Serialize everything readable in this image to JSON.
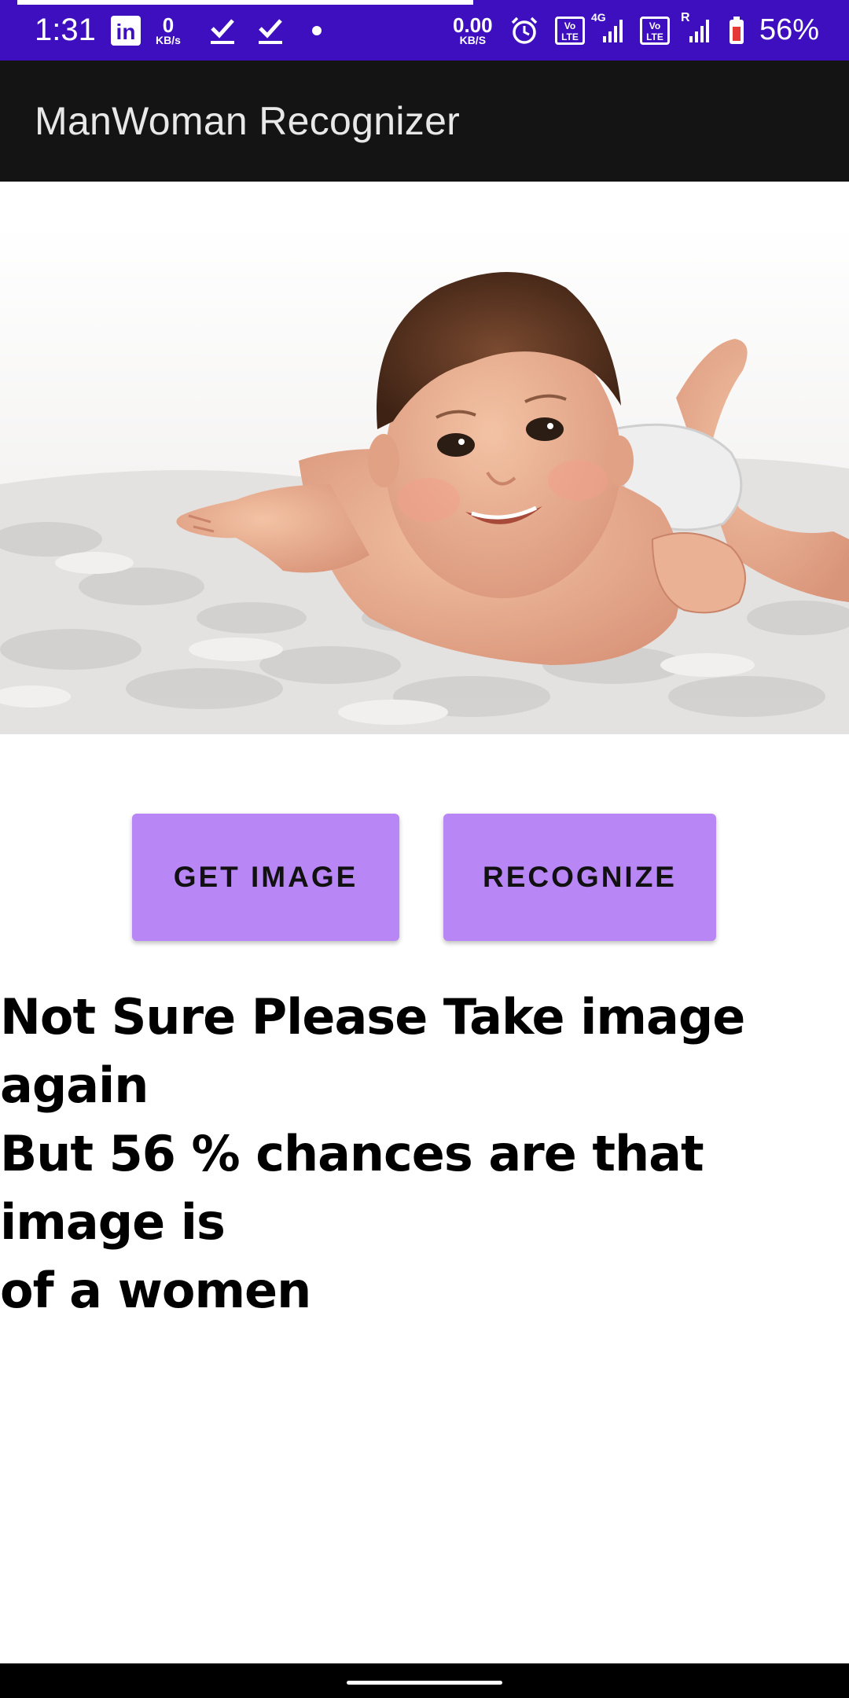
{
  "status_bar": {
    "time": "1:31",
    "speed_left_value": "0",
    "speed_left_unit": "KB/s",
    "speed_right_value": "0.00",
    "speed_right_unit": "KB/S",
    "sim1_network": "4G",
    "sim1_badge": "Vo LTE",
    "sim2_badge": "Vo LTE",
    "sim2_roaming": "R",
    "battery": "56%"
  },
  "app_bar": {
    "title": "ManWoman Recognizer"
  },
  "buttons": {
    "get_image": "GET IMAGE",
    "recognize": "RECOGNIZE"
  },
  "result": {
    "line1": "Not Sure Please Take image again",
    "line2": "But 56 % chances are that image is",
    "line3": "of a women"
  },
  "colors": {
    "status_bar": "#3d0fbf",
    "app_bar": "#141414",
    "button": "#b986f6"
  },
  "icons": [
    "linkedin-icon",
    "check-icon",
    "alarm-icon",
    "signal-icon",
    "battery-icon"
  ]
}
